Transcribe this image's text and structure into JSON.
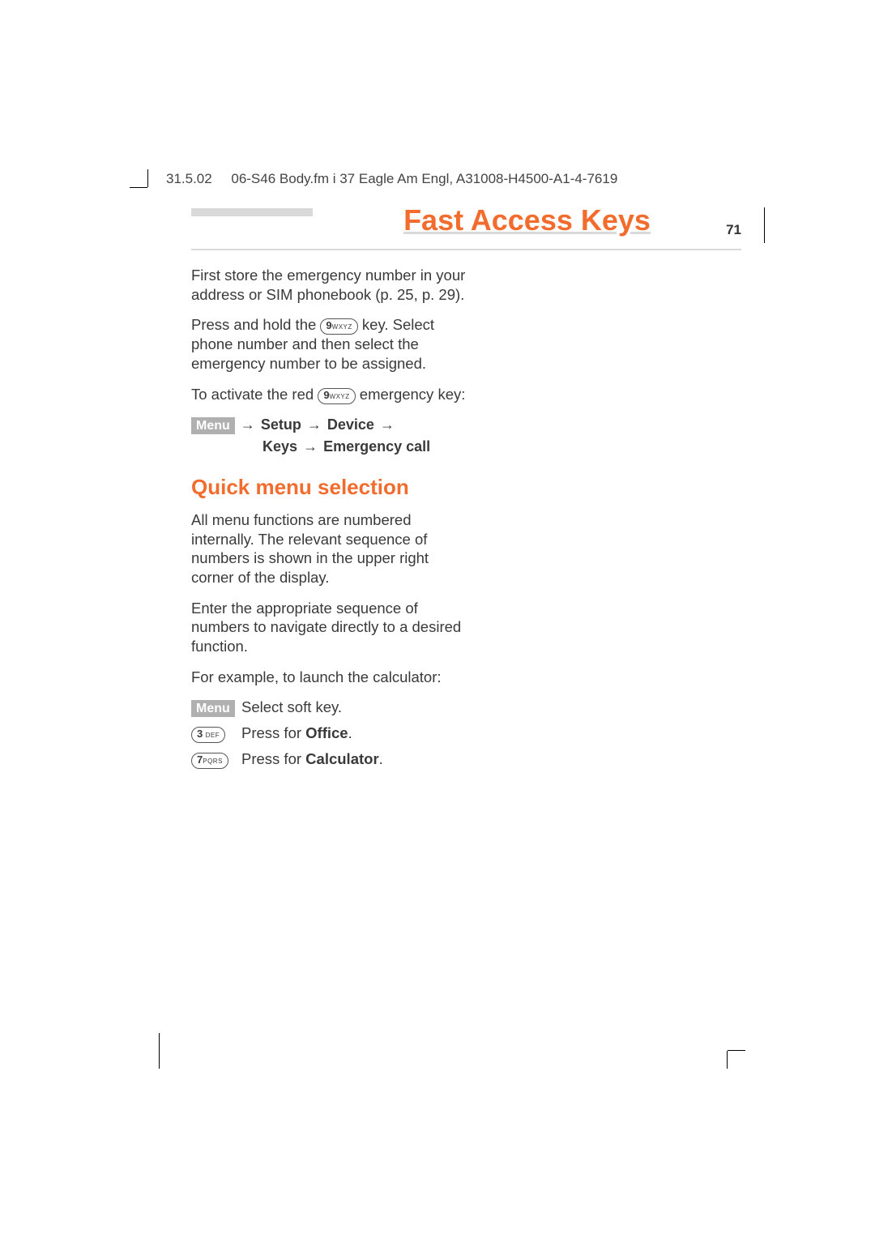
{
  "meta": {
    "date": "31.5.02",
    "doc_segment": "06-S46 Body.fm   i 37 Eagle  Am Engl, A31008-H4500-A1-4-7619"
  },
  "title": "Fast Access Keys",
  "page_number": "71",
  "intro": {
    "p1": "First store the emergency number in your address or SIM phonebook (p. 25, p. 29).",
    "p2a": "Press and hold the ",
    "key9_big": "9",
    "key9_sub": "WXYZ",
    "p2b": " key. Select phone number and then select the emergency number to be assigned.",
    "p3a": "To activate the red ",
    "p3b": " emergency key:"
  },
  "menu": {
    "menu_label": "Menu",
    "setup": "Setup",
    "device": "Device",
    "keys": "Keys",
    "emergency": "Emergency call",
    "arrow": "→"
  },
  "section": {
    "heading": "Quick menu selection",
    "p1": "All menu functions are numbered internally. The relevant sequence of numbers is shown in the upper right corner of the display.",
    "p2": "Enter the appropriate sequence of numbers to navigate directly to a desired function.",
    "p3": "For example, to launch the calculator:"
  },
  "actions": {
    "row1": {
      "text": "Select soft key."
    },
    "row2": {
      "key_big": "3",
      "key_sub": "DEF",
      "text_a": "Press for ",
      "bold": "Office",
      "text_b": "."
    },
    "row3": {
      "key_big": "7",
      "key_sub": "PQRS",
      "text_a": "Press for ",
      "bold": "Calculator",
      "text_b": "."
    }
  }
}
